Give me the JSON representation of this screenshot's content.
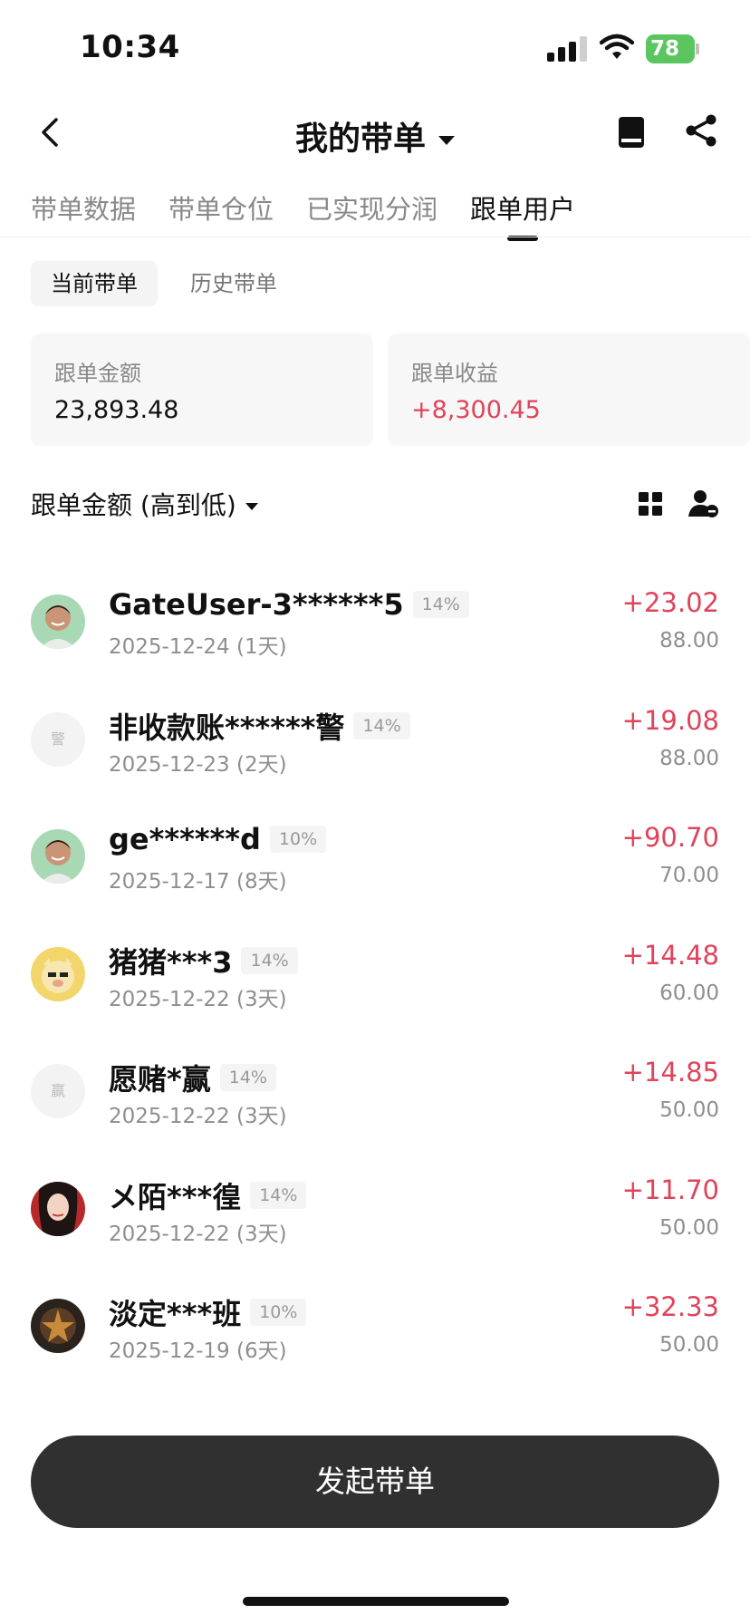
{
  "status_bar": {
    "time": "10:34",
    "battery": "78"
  },
  "nav": {
    "title": "我的带单",
    "icons": [
      "back-icon",
      "book-icon",
      "share-icon"
    ]
  },
  "tabs": [
    {
      "label": "带单数据",
      "active": false
    },
    {
      "label": "带单仓位",
      "active": false
    },
    {
      "label": "已实现分润",
      "active": false
    },
    {
      "label": "跟单用户",
      "active": true
    }
  ],
  "subtabs": [
    {
      "label": "当前带单",
      "active": true
    },
    {
      "label": "历史带单",
      "active": false
    }
  ],
  "stats": {
    "amount_label": "跟单金额",
    "amount_value": "23,893.48",
    "profit_label": "跟单收益",
    "profit_value": "+8,300.45"
  },
  "sort": {
    "label": "跟单金额 (高到低)"
  },
  "users": [
    {
      "name": "GateUser-3******5",
      "pct": "14%",
      "date": "2025-12-24 (1天)",
      "gain": "+23.02",
      "amount": "88.00",
      "avatar": "photo-man"
    },
    {
      "name": "非收款账******警",
      "pct": "14%",
      "date": "2025-12-23 (2天)",
      "gain": "+19.08",
      "amount": "88.00",
      "avatar": "text",
      "avatar_text": "警"
    },
    {
      "name": "ge******d",
      "pct": "10%",
      "date": "2025-12-17 (8天)",
      "gain": "+90.70",
      "amount": "70.00",
      "avatar": "photo-man"
    },
    {
      "name": "猪猪***3",
      "pct": "14%",
      "date": "2025-12-22 (3天)",
      "gain": "+14.48",
      "amount": "60.00",
      "avatar": "pig"
    },
    {
      "name": "愿赌*赢",
      "pct": "14%",
      "date": "2025-12-22 (3天)",
      "gain": "+14.85",
      "amount": "50.00",
      "avatar": "text",
      "avatar_text": "赢"
    },
    {
      "name": "メ陌***徨",
      "pct": "14%",
      "date": "2025-12-22 (3天)",
      "gain": "+11.70",
      "amount": "50.00",
      "avatar": "photo-woman"
    },
    {
      "name": "淡定***班",
      "pct": "10%",
      "date": "2025-12-19 (6天)",
      "gain": "+32.33",
      "amount": "50.00",
      "avatar": "photo-dark"
    }
  ],
  "cta": {
    "label": "发起带单"
  },
  "colors": {
    "positive": "#e0435a",
    "button": "#303030",
    "battery": "#5bc65f"
  }
}
